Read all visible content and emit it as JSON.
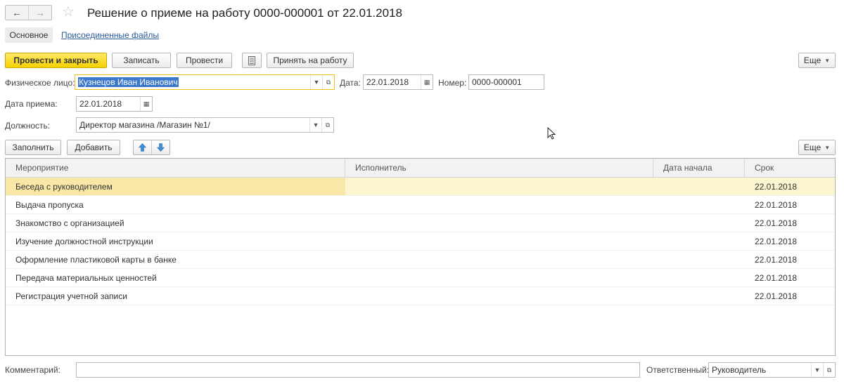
{
  "header": {
    "title": "Решение о приеме на работу 0000-000001 от 22.01.2018",
    "back_icon": "arrow-left-icon",
    "forward_icon": "arrow-right-icon",
    "favorite_icon": "star-icon"
  },
  "tabs": {
    "main": "Основное",
    "attached": "Присоединенные файлы"
  },
  "toolbar": {
    "post_and_close": "Провести и закрыть",
    "save": "Записать",
    "post": "Провести",
    "report_icon": "document-list-icon",
    "hire": "Принять на работу",
    "more": "Еще"
  },
  "form": {
    "person_label": "Физическое лицо:",
    "person_value": "Кузнецов Иван Иванович",
    "date_label": "Дата:",
    "date_value": "22.01.2018",
    "number_label": "Номер:",
    "number_value": "0000-000001",
    "hire_date_label": "Дата приема:",
    "hire_date_value": "22.01.2018",
    "position_label": "Должность:",
    "position_value": "Директор магазина /Магазин №1/"
  },
  "table_toolbar": {
    "fill": "Заполнить",
    "add": "Добавить",
    "up_icon": "arrow-up-icon",
    "down_icon": "arrow-down-icon",
    "more": "Еще"
  },
  "table": {
    "columns": [
      "Мероприятие",
      "Исполнитель",
      "Дата начала",
      "Срок"
    ],
    "rows": [
      {
        "event": "Беседа с руководителем",
        "executor": "",
        "start": "",
        "due": "22.01.2018"
      },
      {
        "event": "Выдача пропуска",
        "executor": "",
        "start": "",
        "due": "22.01.2018"
      },
      {
        "event": "Знакомство с организацией",
        "executor": "",
        "start": "",
        "due": "22.01.2018"
      },
      {
        "event": "Изучение должностной инструкции",
        "executor": "",
        "start": "",
        "due": "22.01.2018"
      },
      {
        "event": "Оформление пластиковой карты в банке",
        "executor": "",
        "start": "",
        "due": "22.01.2018"
      },
      {
        "event": "Передача материальных ценностей",
        "executor": "",
        "start": "",
        "due": "22.01.2018"
      },
      {
        "event": "Регистрация учетной записи",
        "executor": "",
        "start": "",
        "due": "22.01.2018"
      }
    ]
  },
  "footer": {
    "comment_label": "Комментарий:",
    "comment_value": "",
    "responsible_label": "Ответственный:",
    "responsible_value": "Руководитель"
  },
  "colors": {
    "primary_button": "#f6d200",
    "selected_row": "#fbf5d0",
    "link": "#2a5a9a",
    "selection": "#3b78c9"
  }
}
